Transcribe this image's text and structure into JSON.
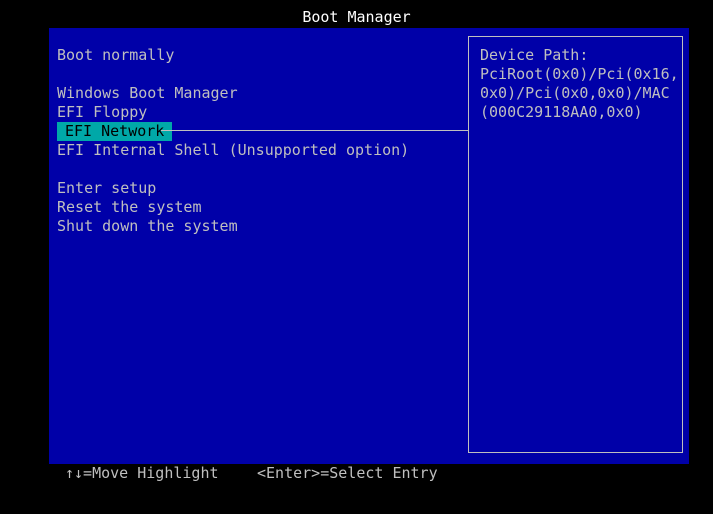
{
  "title": "Boot Manager",
  "menu": {
    "boot_normally": "Boot normally",
    "windows_boot_manager": "Windows Boot Manager",
    "efi_floppy": "EFI Floppy",
    "efi_network": "EFI Network",
    "efi_internal_shell": "EFI Internal Shell (Unsupported option)",
    "enter_setup": "Enter setup",
    "reset_system": "Reset the system",
    "shut_down": "Shut down the system"
  },
  "info": {
    "label": "Device Path:",
    "value": "PciRoot(0x0)/Pci(0x16,0x0)/Pci(0x0,0x0)/MAC(000C29118AA0,0x0)"
  },
  "footer": {
    "move_hint": "↑↓=Move Highlight",
    "select_hint": "<Enter>=Select Entry"
  },
  "colors": {
    "background": "#000000",
    "panel": "#0000a8",
    "highlight": "#00a8a8",
    "text": "#bfbfbf",
    "title": "#ffffff"
  }
}
